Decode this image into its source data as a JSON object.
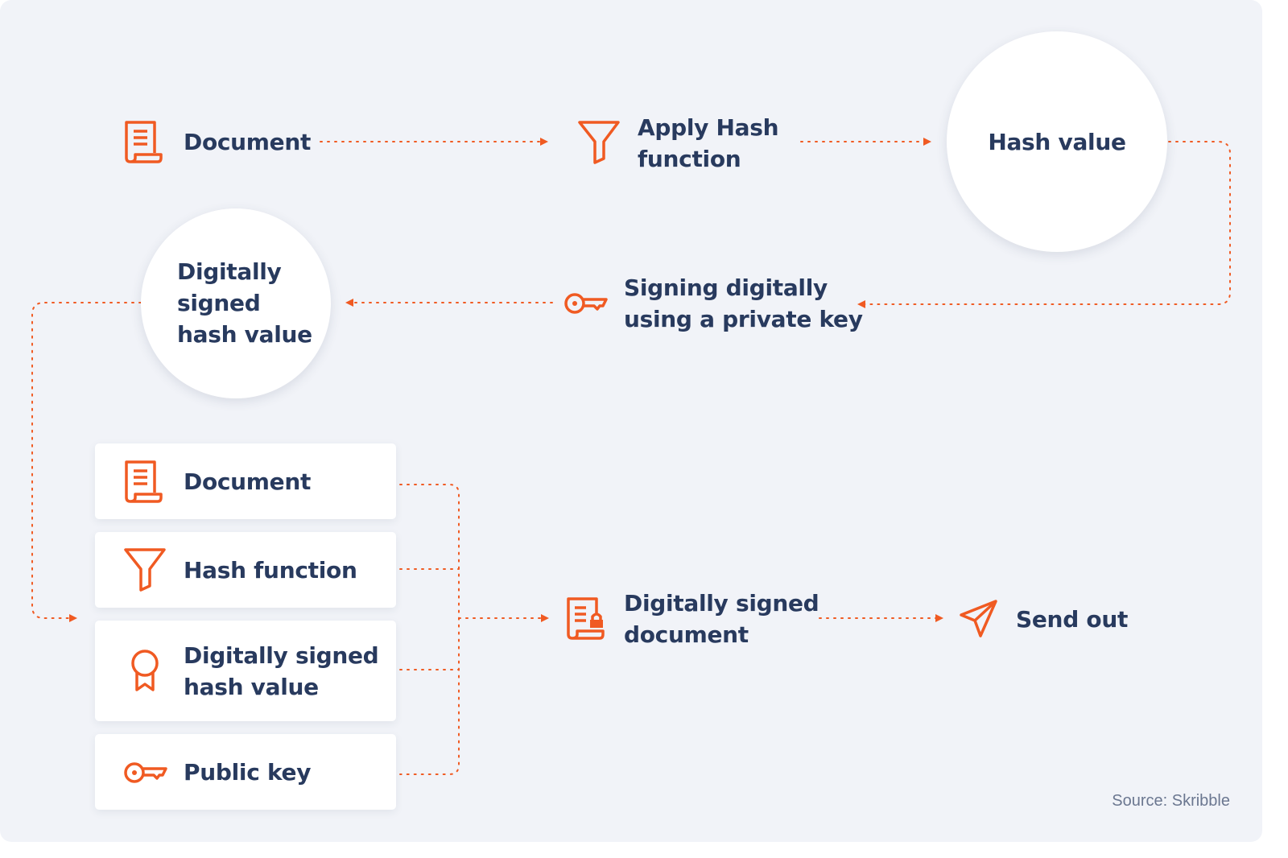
{
  "colors": {
    "accent": "#f05a22",
    "text": "#283a5e",
    "background": "#f1f3f8"
  },
  "steps": {
    "document": {
      "label": "Document",
      "icon": "document-icon"
    },
    "apply_hash": {
      "line1": "Apply Hash",
      "line2": "function",
      "icon": "funnel-icon"
    },
    "hash_value": {
      "label": "Hash value"
    },
    "signing": {
      "line1": "Signing digitally",
      "line2": "using a private key",
      "icon": "key-icon"
    },
    "signed_hash": {
      "line1": "Digitally",
      "line2": "signed",
      "line3": "hash value"
    },
    "bundle": [
      {
        "label": "Document",
        "icon": "document-icon"
      },
      {
        "label": "Hash function",
        "icon": "funnel-icon"
      },
      {
        "line1": "Digitally signed",
        "line2": "hash value",
        "icon": "award-ribbon-icon"
      },
      {
        "label": "Public key",
        "icon": "key-icon"
      }
    ],
    "signed_document": {
      "line1": "Digitally signed",
      "line2": "document",
      "icon": "locked-document-icon"
    },
    "send_out": {
      "label": "Send out",
      "icon": "paper-plane-icon"
    }
  },
  "source": "Source: Skribble"
}
